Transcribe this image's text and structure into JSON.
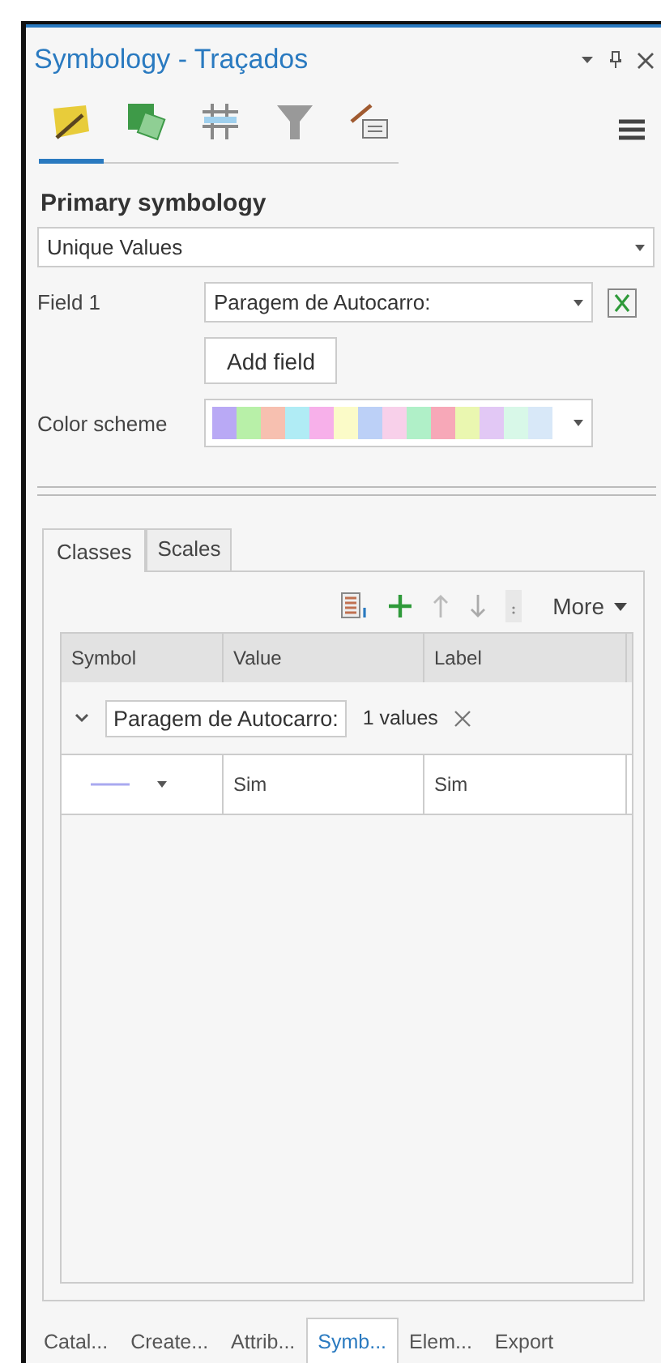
{
  "window": {
    "title": "Symbology - Traçados"
  },
  "icon_tabs": [
    {
      "kind": "primary",
      "selected": true
    },
    {
      "kind": "vary",
      "selected": false
    },
    {
      "kind": "labels",
      "selected": false
    },
    {
      "kind": "filter",
      "selected": false
    },
    {
      "kind": "labelclass",
      "selected": false
    }
  ],
  "section_title": "Primary symbology",
  "renderer": {
    "value": "Unique Values"
  },
  "field1": {
    "label": "Field 1",
    "value": "Paragem de Autocarro:"
  },
  "add_field": "Add field",
  "color_scheme": {
    "label": "Color scheme",
    "swatches": [
      {
        "color": "#b9a9f5"
      },
      {
        "color": "#b8f0a8"
      },
      {
        "color": "#f7c0b0"
      },
      {
        "color": "#b0ecf5"
      },
      {
        "color": "#f7b0ea"
      },
      {
        "color": "#fbfbc8"
      },
      {
        "color": "#bcd0f7"
      },
      {
        "color": "#f8d0ea"
      },
      {
        "color": "#b0f0c8"
      },
      {
        "color": "#f7a8b8"
      },
      {
        "color": "#eaf7b0"
      },
      {
        "color": "#e2c8f5"
      },
      {
        "color": "#d8f8e8"
      },
      {
        "color": "#d8e8f8"
      }
    ]
  },
  "tabs": [
    {
      "label": "Classes",
      "selected": true
    },
    {
      "label": "Scales",
      "selected": false
    }
  ],
  "toolbar": {
    "more": "More"
  },
  "table": {
    "columns": [
      "Symbol",
      "Value",
      "Label"
    ],
    "group": {
      "expanded": true,
      "field": "Paragem de Autocarro:",
      "count": "1 values"
    },
    "rows": [
      {
        "value": "Sim",
        "label": "Sim"
      }
    ]
  },
  "bottom_tabs": [
    {
      "label": "Catal...",
      "selected": false
    },
    {
      "label": "Create...",
      "selected": false
    },
    {
      "label": "Attrib...",
      "selected": false
    },
    {
      "label": "Symb...",
      "selected": true
    },
    {
      "label": "Elem...",
      "selected": false
    },
    {
      "label": "Export",
      "selected": false
    }
  ]
}
